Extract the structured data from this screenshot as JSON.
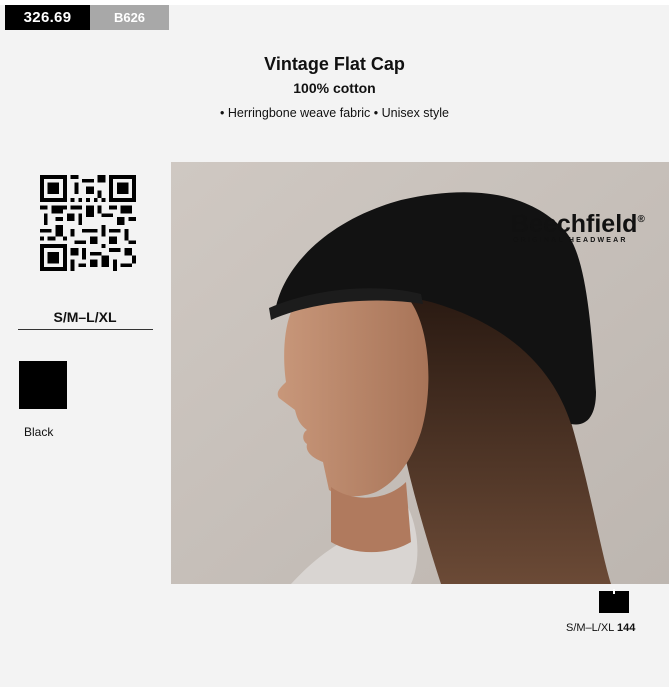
{
  "product_code": {
    "main": "326.69",
    "sub": "B626"
  },
  "title": "Vintage Flat Cap",
  "material": "100% cotton",
  "features": "• Herringbone weave fabric • Unisex style",
  "size": "S/M–L/XL",
  "colors": [
    {
      "name": "Black",
      "hex": "#000000"
    }
  ],
  "brand": {
    "name": "Beechfield",
    "registered": "®",
    "tagline": "ORIGINAL HEADWEAR"
  },
  "packaging": {
    "size": "S/M–L/XL",
    "quantity": "144"
  },
  "icons": [
    "qr-code-icon",
    "carton-icon"
  ]
}
